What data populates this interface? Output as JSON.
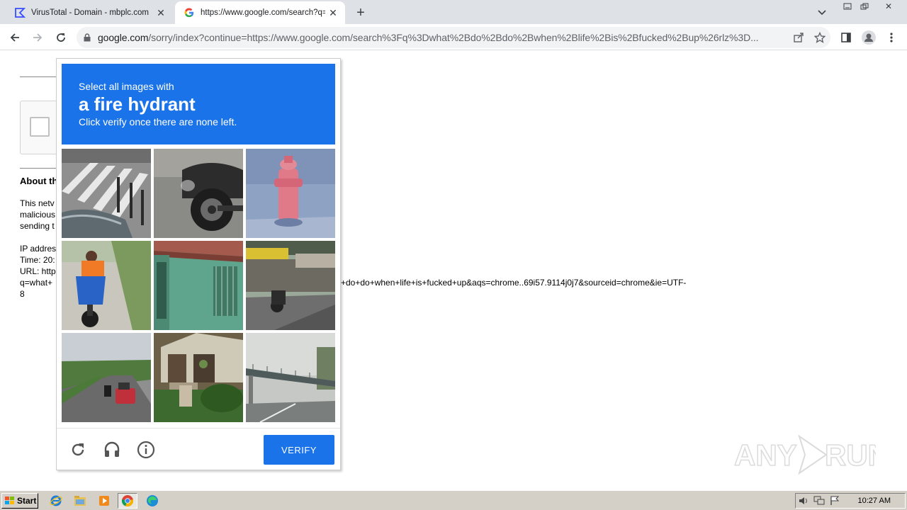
{
  "tabs": [
    {
      "title": "VirusTotal - Domain - mbplc.com",
      "icon": "virustotal-icon",
      "active": false
    },
    {
      "title": "https://www.google.com/search?q=",
      "icon": "google-g-icon",
      "active": true
    }
  ],
  "address_bar": {
    "host": "google.com",
    "path": "/sorry/index?continue=https://www.google.com/search%3Fq%3Dwhat%2Bdo%2Bdo%2Bwhen%2Blife%2Bis%2Bfucked%2Bup%26rlz%3D..."
  },
  "captcha": {
    "instruction": "Select all images with",
    "target": "a fire hydrant",
    "hint": "Click verify once there are none left.",
    "verify_label": "VERIFY",
    "tiles": [
      {
        "name": "crosswalk-tile"
      },
      {
        "name": "motorcycle-wheel-tile"
      },
      {
        "name": "fire-hydrant-tile"
      },
      {
        "name": "motorbike-rider-tile"
      },
      {
        "name": "green-window-tile"
      },
      {
        "name": "street-shops-tile"
      },
      {
        "name": "highway-tile"
      },
      {
        "name": "house-tile"
      },
      {
        "name": "overpass-tile"
      }
    ]
  },
  "page": {
    "about_heading": "About th",
    "para1": [
      "This netv",
      "malicious",
      "sending t"
    ],
    "para2": [
      "IP addres",
      "Time: 20:",
      "URL: http",
      "q=what+",
      "8"
    ],
    "url_continuation": "+do+do+when+life+is+fucked+up&aqs=chrome..69i57.9114j0j7&sourceid=chrome&ie=UTF-"
  },
  "watermark": "ANY RUN",
  "taskbar": {
    "start_label": "Start",
    "clock": "10:27 AM"
  }
}
